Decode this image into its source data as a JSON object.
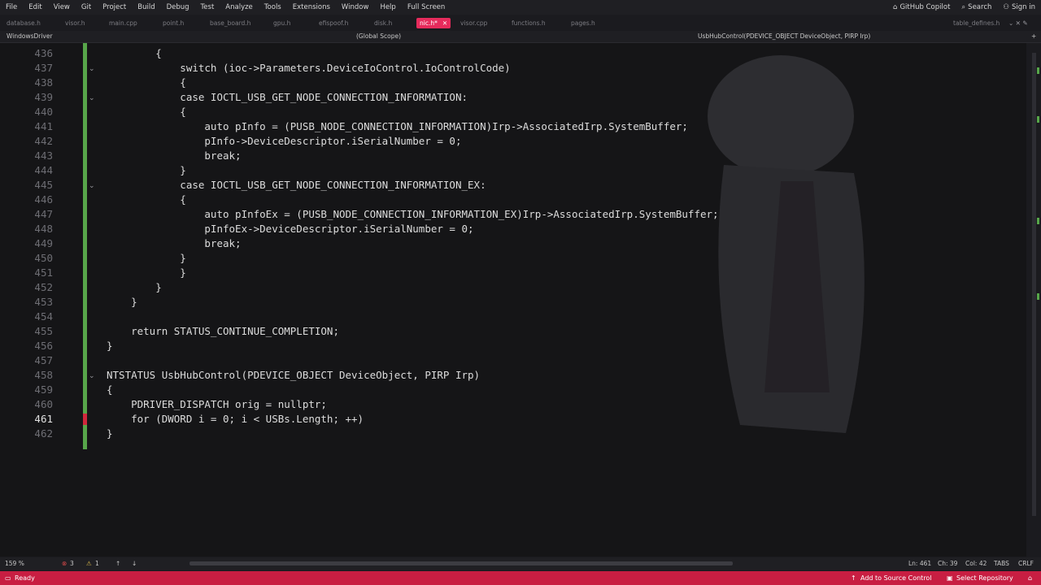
{
  "menu": [
    "File",
    "Edit",
    "View",
    "Git",
    "Project",
    "Build",
    "Debug",
    "Test",
    "Analyze",
    "Tools",
    "Extensions",
    "Window",
    "Help",
    "Full Screen"
  ],
  "menu_right": {
    "copilot": "GitHub Copilot",
    "search": "Search",
    "signin": "Sign in"
  },
  "tabs": [
    {
      "label": "database.h",
      "active": false
    },
    {
      "label": "visor.h",
      "active": false
    },
    {
      "label": "main.cpp",
      "active": false
    },
    {
      "label": "point.h",
      "active": false
    },
    {
      "label": "base_board.h",
      "active": false
    },
    {
      "label": "gpu.h",
      "active": false
    },
    {
      "label": "efispoof.h",
      "active": false
    },
    {
      "label": "disk.h",
      "active": false
    },
    {
      "label": "nic.h*",
      "active": true
    },
    {
      "label": "visor.cpp",
      "active": false
    },
    {
      "label": "functions.h",
      "active": false
    },
    {
      "label": "pages.h",
      "active": false
    }
  ],
  "tab_right": "table_defines.h",
  "nav": {
    "project": "WindowsDriver",
    "scope": "(Global Scope)",
    "member": "UsbHubControl(PDEVICE_OBJECT DeviceObject, PIRP Irp)"
  },
  "code_lines": [
    {
      "n": "436",
      "t": "        {"
    },
    {
      "n": "437",
      "t": "            switch (ioc->Parameters.DeviceIoControl.IoControlCode)"
    },
    {
      "n": "438",
      "t": "            {"
    },
    {
      "n": "439",
      "t": "            case IOCTL_USB_GET_NODE_CONNECTION_INFORMATION:"
    },
    {
      "n": "440",
      "t": "            {"
    },
    {
      "n": "441",
      "t": "                auto pInfo = (PUSB_NODE_CONNECTION_INFORMATION)Irp->AssociatedIrp.SystemBuffer;"
    },
    {
      "n": "442",
      "t": "                pInfo->DeviceDescriptor.iSerialNumber = 0;"
    },
    {
      "n": "443",
      "t": "                break;"
    },
    {
      "n": "444",
      "t": "            }"
    },
    {
      "n": "445",
      "t": "            case IOCTL_USB_GET_NODE_CONNECTION_INFORMATION_EX:"
    },
    {
      "n": "446",
      "t": "            {"
    },
    {
      "n": "447",
      "t": "                auto pInfoEx = (PUSB_NODE_CONNECTION_INFORMATION_EX)Irp->AssociatedIrp.SystemBuffer;"
    },
    {
      "n": "448",
      "t": "                pInfoEx->DeviceDescriptor.iSerialNumber = 0;"
    },
    {
      "n": "449",
      "t": "                break;"
    },
    {
      "n": "450",
      "t": "            }"
    },
    {
      "n": "451",
      "t": "            }"
    },
    {
      "n": "452",
      "t": "        }"
    },
    {
      "n": "453",
      "t": "    }"
    },
    {
      "n": "454",
      "t": ""
    },
    {
      "n": "455",
      "t": "    return STATUS_CONTINUE_COMPLETION;"
    },
    {
      "n": "456",
      "t": "}"
    },
    {
      "n": "457",
      "t": ""
    },
    {
      "n": "458",
      "t": "NTSTATUS UsbHubControl(PDEVICE_OBJECT DeviceObject, PIRP Irp)"
    },
    {
      "n": "459",
      "t": "{"
    },
    {
      "n": "460",
      "t": "    PDRIVER_DISPATCH orig = nullptr;"
    },
    {
      "n": "461",
      "t": "    for (DWORD i = 0; i < USBs.Length; ++)"
    },
    {
      "n": "462",
      "t": "}"
    }
  ],
  "fold_lines": [
    "437",
    "439",
    "445",
    "458"
  ],
  "current_line": "461",
  "status_bottom": {
    "zoom": "159 %",
    "errors": "3",
    "warnings": "1",
    "ln": "Ln: 461",
    "ch": "Ch: 39",
    "col": "Col: 42",
    "tabs": "TABS",
    "eol": "CRLF"
  },
  "statusbar": {
    "ready": "Ready",
    "source": "Add to Source Control",
    "repo": "Select Repository"
  },
  "colors": {
    "accent": "#e62b5c",
    "statusbar": "#c81e42",
    "change_bar": "#57a64a"
  }
}
